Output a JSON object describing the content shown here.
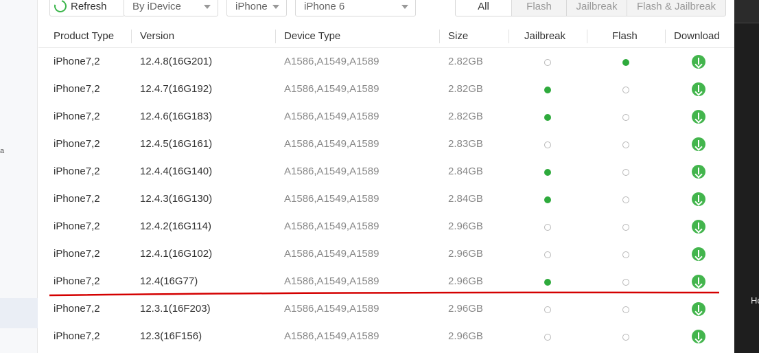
{
  "toolbar": {
    "refresh_label": "Refresh",
    "device_filter": "By iDevice",
    "device_family": "iPhone",
    "device_model": "iPhone 6"
  },
  "filter_tabs": [
    {
      "label": "All",
      "active": true
    },
    {
      "label": "Flash",
      "active": false
    },
    {
      "label": "Jailbreak",
      "active": false
    },
    {
      "label": "Flash & Jailbreak",
      "active": false
    }
  ],
  "table": {
    "columns": [
      "Product Type",
      "Version",
      "Device Type",
      "Size",
      "Jailbreak",
      "Flash",
      "Download"
    ],
    "rows": [
      {
        "product": "iPhone7,2",
        "version": "12.4.8(16G201)",
        "device": "A1586,A1549,A1589",
        "size": "2.82GB",
        "jailbreak": false,
        "flash": true
      },
      {
        "product": "iPhone7,2",
        "version": "12.4.7(16G192)",
        "device": "A1586,A1549,A1589",
        "size": "2.82GB",
        "jailbreak": true,
        "flash": false
      },
      {
        "product": "iPhone7,2",
        "version": "12.4.6(16G183)",
        "device": "A1586,A1549,A1589",
        "size": "2.82GB",
        "jailbreak": true,
        "flash": false
      },
      {
        "product": "iPhone7,2",
        "version": "12.4.5(16G161)",
        "device": "A1586,A1549,A1589",
        "size": "2.83GB",
        "jailbreak": false,
        "flash": false
      },
      {
        "product": "iPhone7,2",
        "version": "12.4.4(16G140)",
        "device": "A1586,A1549,A1589",
        "size": "2.84GB",
        "jailbreak": true,
        "flash": false
      },
      {
        "product": "iPhone7,2",
        "version": "12.4.3(16G130)",
        "device": "A1586,A1549,A1589",
        "size": "2.84GB",
        "jailbreak": true,
        "flash": false
      },
      {
        "product": "iPhone7,2",
        "version": "12.4.2(16G114)",
        "device": "A1586,A1549,A1589",
        "size": "2.96GB",
        "jailbreak": false,
        "flash": false
      },
      {
        "product": "iPhone7,2",
        "version": "12.4.1(16G102)",
        "device": "A1586,A1549,A1589",
        "size": "2.96GB",
        "jailbreak": false,
        "flash": false
      },
      {
        "product": "iPhone7,2",
        "version": "12.4(16G77)",
        "device": "A1586,A1549,A1589",
        "size": "2.96GB",
        "jailbreak": true,
        "flash": false
      },
      {
        "product": "iPhone7,2",
        "version": "12.3.1(16F203)",
        "device": "A1586,A1549,A1589",
        "size": "2.96GB",
        "jailbreak": false,
        "flash": false
      },
      {
        "product": "iPhone7,2",
        "version": "12.3(16F156)",
        "device": "A1586,A1549,A1589",
        "size": "2.96GB",
        "jailbreak": false,
        "flash": false
      }
    ]
  },
  "side_stubs": {
    "left": "a",
    "right": "Ho"
  },
  "colors": {
    "accent_green": "#43b54d",
    "dot_green": "#2eaa3c",
    "annotation_red": "#d40000"
  },
  "icons": {
    "refresh": "refresh-icon",
    "download": "download-icon",
    "caret": "chevron-down-icon"
  }
}
